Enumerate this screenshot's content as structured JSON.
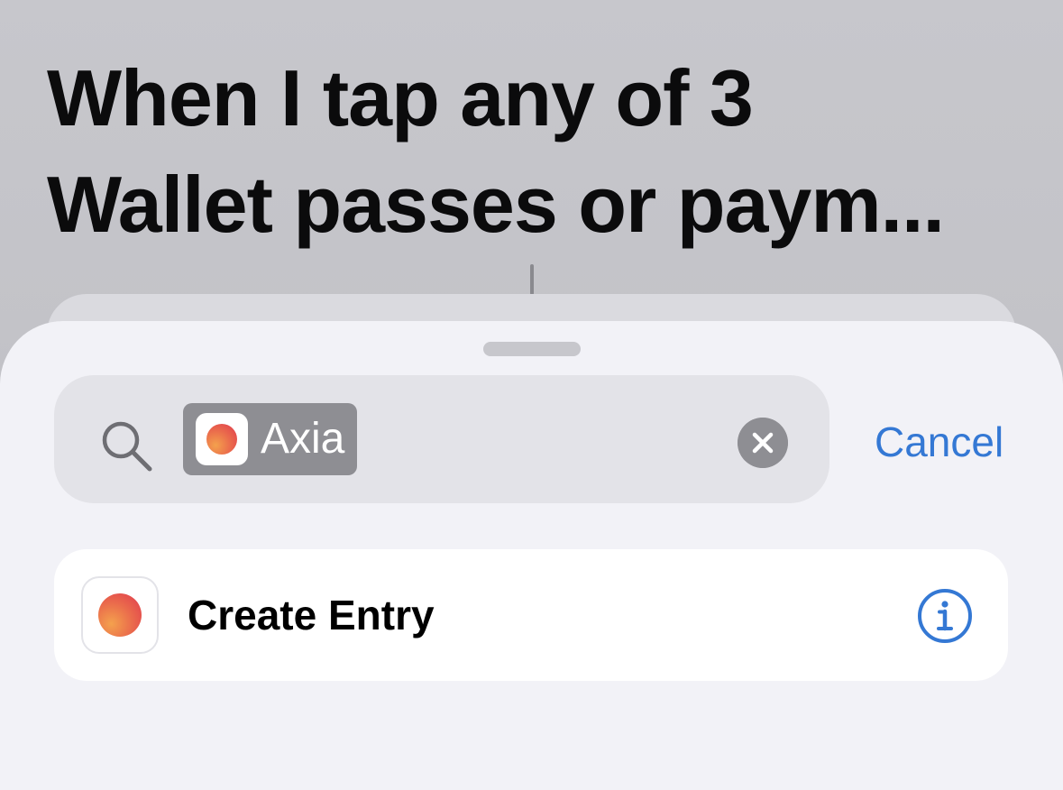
{
  "header": {
    "title_line1": "When I tap any of 3",
    "title_line2": "Wallet passes or paym..."
  },
  "search": {
    "token_label": "Axia",
    "token_icon": "axia-app-icon",
    "search_icon": "search-icon",
    "clear_icon": "clear-x-icon",
    "cancel_label": "Cancel"
  },
  "results": [
    {
      "label": "Create Entry",
      "app_icon": "axia-app-icon",
      "info_icon": "info-circle-icon"
    }
  ],
  "colors": {
    "accent": "#3478d4",
    "app_gradient_start": "#f4a14d",
    "app_gradient_end": "#e0394e"
  }
}
